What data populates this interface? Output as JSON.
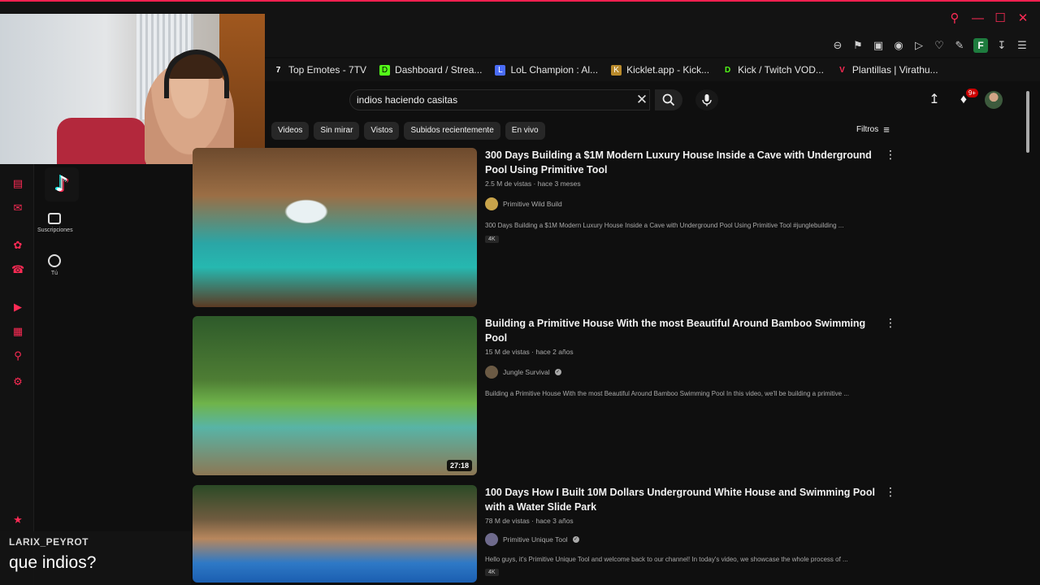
{
  "browser": {
    "bookmarks": [
      {
        "label": "Top Emotes - 7TV",
        "color": "#ffffff",
        "glyph": "7"
      },
      {
        "label": "Dashboard / Strea...",
        "color": "#53fc18",
        "glyph": "D"
      },
      {
        "label": "LoL Champion : Al...",
        "color": "#4a6cf7",
        "glyph": "L"
      },
      {
        "label": "Kicklet.app - Kick...",
        "color": "#b98a2b",
        "glyph": "K"
      },
      {
        "label": "Kick / Twitch VOD...",
        "color": "#53fc18",
        "glyph": "D"
      },
      {
        "label": "Plantillas | Virathu...",
        "color": "#ff2b55",
        "glyph": "V"
      }
    ],
    "profile_initial": "F",
    "accent_color": "#ff2050"
  },
  "youtube": {
    "search_query": "indios haciendo casitas",
    "notification_badge": "9+",
    "side": [
      {
        "label": "Suscripciones"
      },
      {
        "label": "Tú"
      }
    ],
    "chips": [
      "Videos",
      "Sin mirar",
      "Vistos",
      "Subidos recientemente",
      "En vivo"
    ],
    "filters_label": "Filtros",
    "results": [
      {
        "title": "300 Days Building a $1M Modern Luxury House Inside a Cave with Underground Pool Using Primitive Tool",
        "meta": "2.5 M de vistas · hace 3 meses",
        "channel": "Primitive Wild Build",
        "description": "300 Days Building a $1M Modern Luxury House Inside a Cave with Underground Pool Using Primitive Tool #junglebuilding ...",
        "badge": "4K",
        "duration": ""
      },
      {
        "title": "Building a Primitive House With the most Beautiful Around Bamboo Swimming Pool",
        "meta": "15 M de vistas · hace 2 años",
        "channel": "Jungle Survival",
        "description": "Building a Primitive House With the most Beautiful Around Bamboo Swimming Pool In this video, we'll be building a primitive ...",
        "badge": "",
        "duration": "27:18"
      },
      {
        "title": "100 Days How I Built 10M Dollars Underground White House and Swimming Pool with a Water Slide Park",
        "meta": "78 M de vistas · hace 3 años",
        "channel": "Primitive Unique Tool",
        "description": "Hello guys, it's Primitive Unique Tool and welcome back to our channel! In today's video, we showcase the whole process of ...",
        "badge": "4K",
        "duration": ""
      }
    ]
  },
  "chat": {
    "username": "LARIX_PEYROT",
    "message": "que indios?"
  }
}
